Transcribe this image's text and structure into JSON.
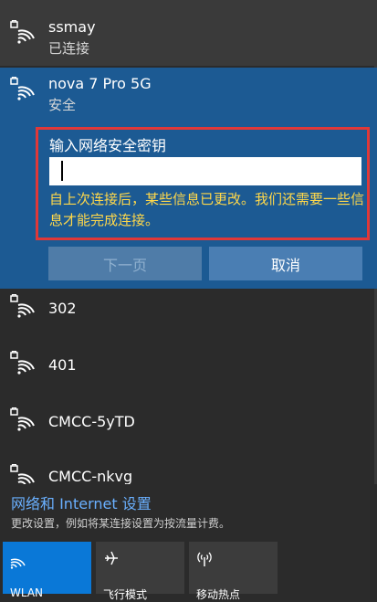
{
  "networks": {
    "current": {
      "name": "ssmay",
      "status": "已连接"
    },
    "selected": {
      "name": "nova 7 Pro 5G",
      "security": "安全",
      "key_prompt": "输入网络安全密钥",
      "key_value": "",
      "warning": "自上次连接后，某些信息已更改。我们还需要一些信息才能完成连接。",
      "next_label": "下一页",
      "cancel_label": "取消"
    },
    "list": [
      {
        "name": "302"
      },
      {
        "name": "401"
      },
      {
        "name": "CMCC-5yTD"
      },
      {
        "name": "CMCC-nkvg"
      }
    ]
  },
  "settings": {
    "link_label": "网络和 Internet 设置",
    "description": "更改设置，例如将某连接设置为按流量计费。"
  },
  "quick_actions": [
    {
      "label": "WLAN",
      "icon": "wifi-icon",
      "state": "on"
    },
    {
      "label": "飞行模式",
      "icon": "airplane-icon",
      "state": "off"
    },
    {
      "label": "移动热点",
      "icon": "hotspot-icon",
      "state": "off"
    }
  ],
  "colors": {
    "accent": "#0a78d7",
    "selected_bg": "#1c5a93",
    "warning": "#ffd84a",
    "highlight_border": "#e03838"
  }
}
